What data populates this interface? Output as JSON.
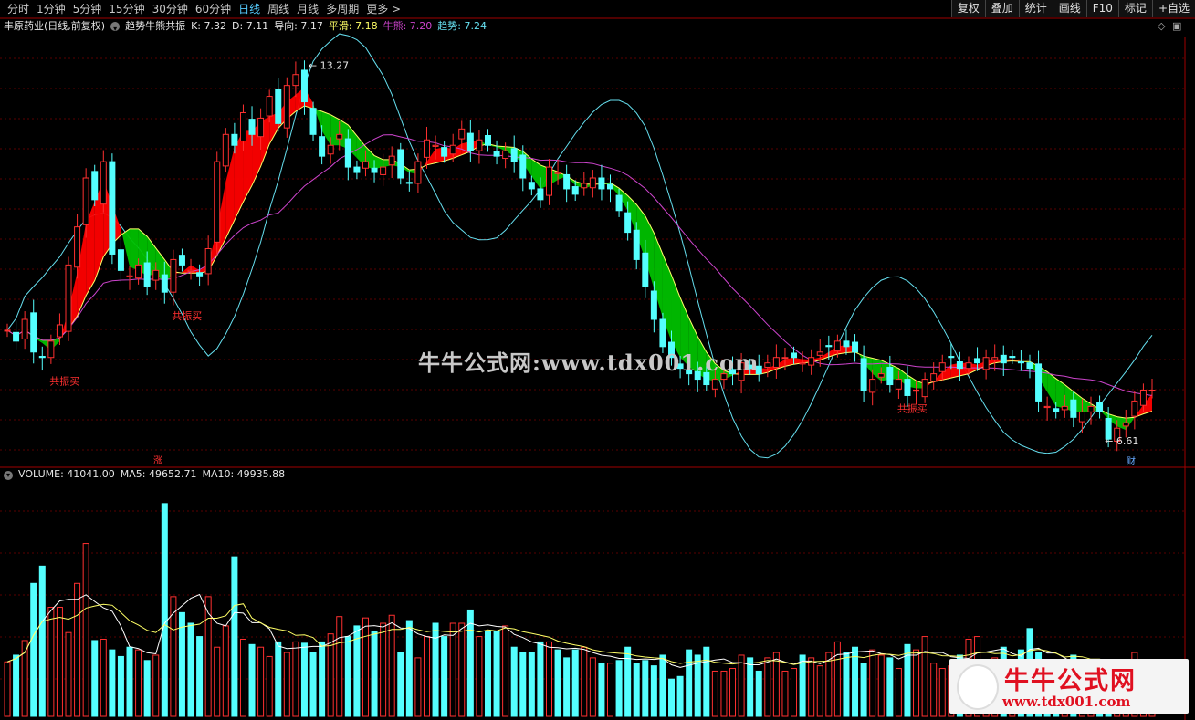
{
  "periods": [
    "分时",
    "1分钟",
    "5分钟",
    "15分钟",
    "30分钟",
    "60分钟",
    "日线",
    "周线",
    "月线",
    "多周期",
    "更多"
  ],
  "active_period": "日线",
  "tools": [
    "复权",
    "叠加",
    "统计",
    "画线",
    "F10",
    "标记",
    "+自选"
  ],
  "info": {
    "stock": "丰原药业(日线,前复权)",
    "indicator": "趋势牛熊共振",
    "k": "K: 7.32",
    "d": "D: 7.11",
    "daoxiang": "导向: 7.17",
    "pinghua": "平滑: 7.18",
    "niuxiong": "牛熊: 7.20",
    "qushi": "趋势: 7.24"
  },
  "volume_info": {
    "volume": "VOLUME: 41041.00",
    "ma5": "MA5: 49652.71",
    "ma10": "MA10: 49935.88"
  },
  "watermark": "牛牛公式网:www.tdx001.com",
  "logo": {
    "title": "牛牛公式网",
    "url": "www.tdx001.com"
  },
  "colors": {
    "up": "#ff3030",
    "down": "#54ffff",
    "bull_band": "#ff0000",
    "bear_band": "#00c000",
    "pinghua": "#ffff66",
    "niuxiong": "#cc44cc",
    "qushi_envelope": "#66e0f0"
  },
  "chart_data": {
    "type": "candlestick",
    "price_annotations": {
      "high": "13.27",
      "low": "6.61"
    },
    "signals": [
      "共振买",
      "共振买",
      "共振买"
    ],
    "markers": {
      "zhang": "涨",
      "cai": "财"
    },
    "price_close": [
      8.4,
      8.2,
      8.6,
      8.0,
      7.9,
      8.2,
      8.5,
      9.6,
      10.3,
      11.2,
      10.8,
      11.5,
      9.8,
      9.5,
      9.4,
      9.6,
      9.2,
      9.5,
      9.1,
      9.7,
      9.6,
      9.5,
      9.4,
      9.9,
      11.5,
      12.0,
      11.8,
      12.4,
      12.0,
      12.3,
      12.7,
      12.2,
      12.9,
      13.1,
      12.6,
      12.0,
      11.6,
      11.8,
      12.0,
      11.4,
      11.3,
      11.5,
      11.3,
      11.4,
      11.6,
      11.2,
      11.1,
      11.5,
      11.9,
      11.8,
      11.6,
      11.8,
      12.1,
      11.7,
      11.9,
      11.8,
      11.6,
      11.7,
      11.5,
      11.2,
      11.0,
      10.8,
      11.4,
      11.3,
      11.0,
      10.9,
      11.1,
      11.2,
      11.0,
      11.0,
      10.6,
      10.2,
      9.7,
      9.2,
      8.6,
      8.1,
      7.9,
      7.7,
      7.6,
      7.5,
      7.4,
      7.5,
      7.6,
      7.6,
      7.8,
      7.7,
      7.6,
      7.8,
      7.9,
      7.9,
      7.9,
      7.8,
      7.9,
      8.0,
      8.1,
      8.2,
      8.1,
      8.0,
      7.3,
      7.5,
      7.6,
      7.4,
      7.5,
      7.2,
      7.3,
      7.5,
      7.6,
      7.8,
      7.9,
      7.7,
      7.8,
      7.8,
      7.9,
      7.9,
      7.8,
      7.9,
      7.8,
      7.7,
      7.1,
      7.0,
      6.9,
      7.0,
      6.8,
      6.9,
      7.0,
      6.9,
      6.4,
      6.6,
      6.7,
      7.1,
      7.3,
      7.3
    ],
    "volume": [
      41,
      46,
      57,
      100,
      113,
      82,
      82,
      63,
      100,
      130,
      57,
      58,
      50,
      45,
      52,
      50,
      42,
      46,
      160,
      90,
      78,
      70,
      60,
      90,
      52,
      68,
      120,
      58,
      54,
      52,
      45,
      56,
      48,
      56,
      55,
      48,
      56,
      62,
      75,
      60,
      68,
      74,
      64,
      70,
      76,
      48,
      72,
      44,
      60,
      70,
      60,
      70,
      70,
      80,
      60,
      64,
      64,
      68,
      52,
      48,
      48,
      56,
      56,
      50,
      44,
      50,
      52,
      44,
      40,
      40,
      42,
      52,
      40,
      42,
      38,
      46,
      28,
      30,
      50,
      46,
      52,
      34,
      34,
      36,
      46,
      44,
      34,
      44,
      48,
      34,
      36,
      46,
      44,
      38,
      48,
      56,
      48,
      52,
      40,
      50,
      46,
      44,
      36,
      54,
      50,
      60,
      40,
      36,
      38,
      46,
      58,
      60,
      40,
      44,
      52,
      40,
      50,
      66,
      48,
      34,
      40,
      32,
      46,
      40,
      34,
      40,
      30,
      38,
      42,
      48,
      40,
      41
    ]
  }
}
